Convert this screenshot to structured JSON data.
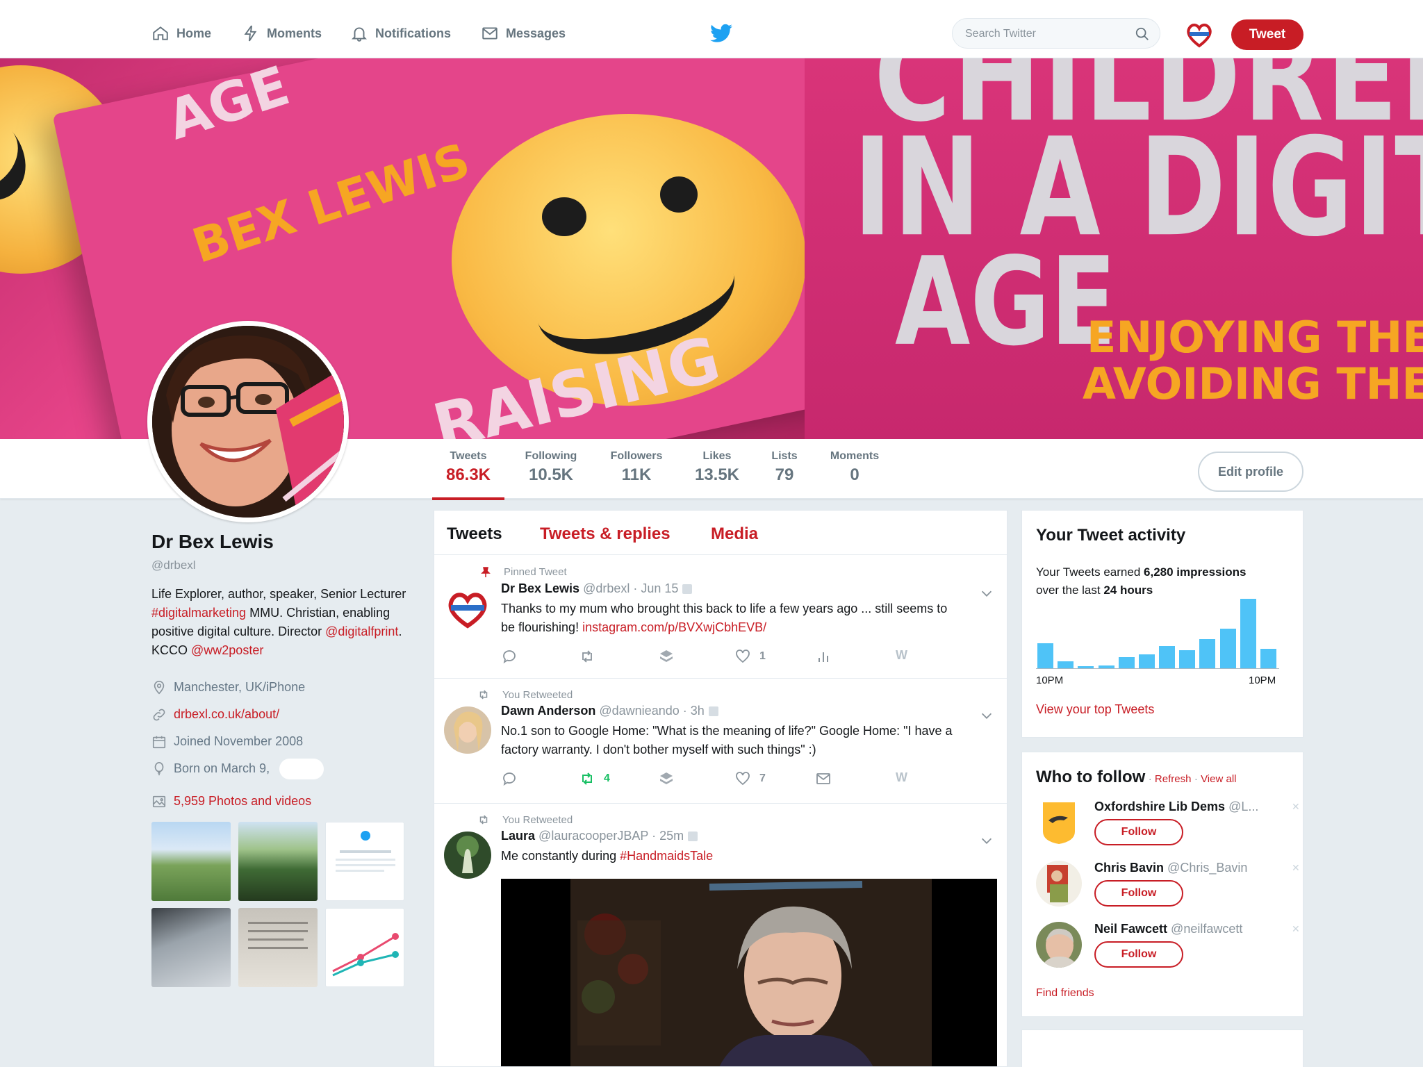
{
  "nav": {
    "home": "Home",
    "moments": "Moments",
    "notifications": "Notifications",
    "messages": "Messages",
    "search_placeholder": "Search Twitter",
    "tweet_button": "Tweet",
    "icons": [
      "home-icon",
      "lightning-icon",
      "bell-icon",
      "envelope-icon",
      "twitter-bird-icon",
      "search-icon"
    ]
  },
  "banner": {
    "text_left": "BEX LEWIS",
    "text_age_small": "AGE",
    "text_raising": "RAISING",
    "text_children": "CHILDREN",
    "text_in_a_digital": "IN A DIGITAL",
    "text_age": "AGE",
    "text_enjoying": "ENJOYING THE",
    "text_avoiding": "AVOIDING THE"
  },
  "stats": [
    {
      "label": "Tweets",
      "value": "86.3K",
      "active": true
    },
    {
      "label": "Following",
      "value": "10.5K"
    },
    {
      "label": "Followers",
      "value": "11K"
    },
    {
      "label": "Likes",
      "value": "13.5K"
    },
    {
      "label": "Lists",
      "value": "79"
    },
    {
      "label": "Moments",
      "value": "0"
    }
  ],
  "edit_profile": "Edit profile",
  "profile": {
    "name": "Dr Bex Lewis",
    "handle": "@drbexl",
    "bio": {
      "p1": "Life Explorer, author, speaker, Senior Lecturer ",
      "tag1": "#digitalmarketing",
      "p2": " MMU. Christian, enabling positive digital culture. Director ",
      "mention1": "@digitalfprint",
      "p3": ". KCCO ",
      "mention2": "@ww2poster"
    },
    "location": "Manchester, UK/iPhone",
    "website": "drbexl.co.uk/about/",
    "joined": "Joined November 2008",
    "born": "Born on March 9,",
    "photos": "5,959 Photos and videos"
  },
  "tabs": {
    "tweets": "Tweets",
    "replies": "Tweets & replies",
    "media": "Media"
  },
  "tweets": [
    {
      "context": "Pinned Tweet",
      "name": "Dr Bex Lewis",
      "handle": "@drbexl",
      "time": "· Jun 15",
      "text": "Thanks to my mum who brought this back to life a few years ago ... still seems to be flourishing! ",
      "link": "instagram.com/p/BVXwjCbhEVB/",
      "likes": "1"
    },
    {
      "context": "You Retweeted",
      "name": "Dawn Anderson",
      "handle": "@dawnieando",
      "time": "· 3h",
      "text": "No.1 son to Google Home: \"What is the meaning of life?\" Google Home: \"I have a factory warranty. I don't bother myself with such things\" :)",
      "retweets": "4",
      "likes": "7"
    },
    {
      "context": "You Retweeted",
      "name": "Laura",
      "handle": "@lauracooperJBAP",
      "time": "· 25m",
      "text": "Me constantly during ",
      "hashtag": "#HandmaidsTale"
    }
  ],
  "activity": {
    "title": "Your Tweet activity",
    "line1": "Your Tweets earned ",
    "impressions": "6,280 impressions",
    "line2": "over the last ",
    "hours": "24 hours",
    "x_start": "10PM",
    "x_end": "10PM",
    "link": "View your top Tweets",
    "bars": [
      0.36,
      0.1,
      0.03,
      0.04,
      0.16,
      0.2,
      0.32,
      0.26,
      0.42,
      0.57,
      1.0,
      0.28
    ]
  },
  "who_to_follow": {
    "title": "Who to follow",
    "refresh": "Refresh",
    "view_all": "View all",
    "follow_label": "Follow",
    "users": [
      {
        "name": "Oxfordshire Lib Dems",
        "handle": "@L..."
      },
      {
        "name": "Chris Bavin",
        "handle": "@Chris_Bavin"
      },
      {
        "name": "Neil Fawcett",
        "handle": "@neilfawcett"
      }
    ],
    "find_friends": "Find friends"
  },
  "colors": {
    "accent": "#c81d25",
    "bar": "#4fc3f7",
    "background": "#e6ecf0"
  }
}
